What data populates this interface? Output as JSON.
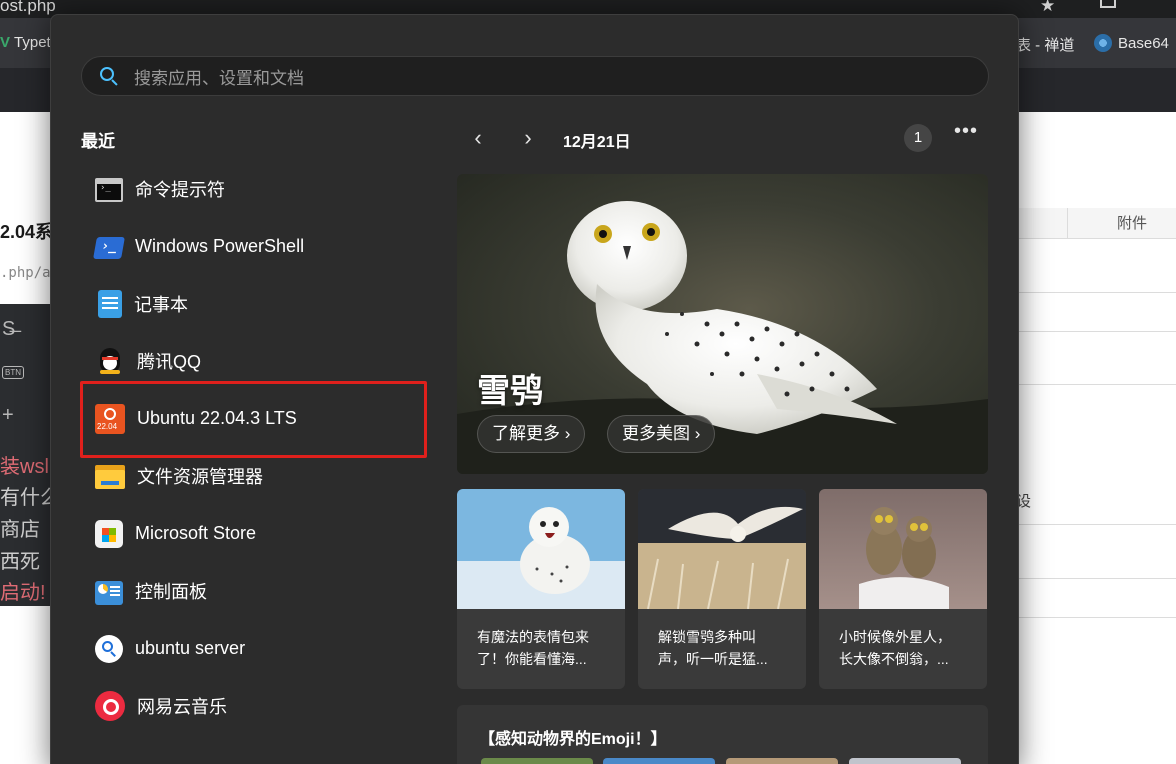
{
  "background": {
    "url_fragment": "ost.php",
    "bookmark_left": "Typet",
    "bookmark_zen": "表 - 禅道",
    "bookmark_base64": "Base64",
    "page_title_fragment": "2.04系",
    "page_path_fragment": ".php/a",
    "table_header": "附件",
    "editor_btn": "BTN",
    "editor_lines": [
      "装wsl",
      "有什么",
      "商店",
      "西死",
      "启动!"
    ],
    "right_faint": "设"
  },
  "search": {
    "placeholder": "搜索应用、设置和文档"
  },
  "recent": {
    "title": "最近",
    "items": [
      {
        "label": "命令提示符",
        "icon": "cmd-icon"
      },
      {
        "label": "Windows PowerShell",
        "icon": "powershell-icon"
      },
      {
        "label": "记事本",
        "icon": "notepad-icon"
      },
      {
        "label": "腾讯QQ",
        "icon": "qq-icon"
      },
      {
        "label": "Ubuntu 22.04.3 LTS",
        "icon": "ubuntu-icon",
        "icon_text": "22.04"
      },
      {
        "label": "文件资源管理器",
        "icon": "folder-icon"
      },
      {
        "label": "Microsoft Store",
        "icon": "store-icon"
      },
      {
        "label": "控制面板",
        "icon": "control-panel-icon"
      },
      {
        "label": "ubuntu server",
        "icon": "search-icon"
      },
      {
        "label": "网易云音乐",
        "icon": "netease-music-icon"
      }
    ]
  },
  "widgets": {
    "date": "12月21日",
    "badge": "1",
    "more": "•••",
    "hero": {
      "title": "雪鸮",
      "btn_learn": "了解更多 ›",
      "btn_more": "更多美图 ›"
    },
    "cards": [
      {
        "text": "有魔法的表情包来\n了！你能看懂海..."
      },
      {
        "text": "解锁雪鸮多种叫\n声，听一听是猛..."
      },
      {
        "text": "小时候像外星人，\n长大像不倒翁，..."
      }
    ],
    "bottom_title": "【感知动物界的Emoji！】"
  },
  "colors": {
    "accent": "#4cc2ff",
    "highlight": "#e0201c",
    "menu_bg": "#2c2c2c"
  }
}
